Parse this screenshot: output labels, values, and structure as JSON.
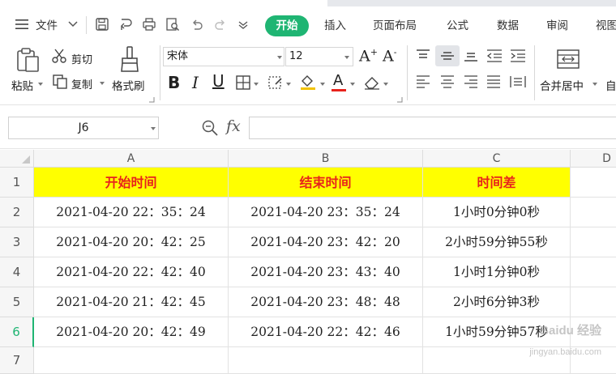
{
  "menu": {
    "file_label": "文件",
    "tabs": [
      "开始",
      "插入",
      "页面布局",
      "公式",
      "数据",
      "审阅",
      "视图"
    ],
    "active_tab": "开始"
  },
  "ribbon": {
    "paste_label": "粘贴",
    "cut_label": "剪切",
    "copy_label": "复制",
    "format_painter_label": "格式刷",
    "font_name": "宋体",
    "font_size": "12",
    "merge_label": "合并居中",
    "auto_label": "自"
  },
  "formula_bar": {
    "cell_ref": "J6",
    "fx_label": "fx",
    "content": ""
  },
  "sheet": {
    "columns": [
      "A",
      "B",
      "C",
      "D"
    ],
    "rows": [
      "1",
      "2",
      "3",
      "4",
      "5",
      "6",
      "7"
    ],
    "selected_row": "6",
    "headers": [
      "开始时间",
      "结束时间",
      "时间差"
    ],
    "data": [
      [
        "2021-04-20 22：35：24",
        "2021-04-20 23：35：24",
        "1小时0分钟0秒"
      ],
      [
        "2021-04-20 20：42：25",
        "2021-04-20 23：42：20",
        "2小时59分钟55秒"
      ],
      [
        "2021-04-20 22：42：40",
        "2021-04-20 23：43：40",
        "1小时1分钟0秒"
      ],
      [
        "2021-04-20 21：42：45",
        "2021-04-20 23：48：48",
        "2小时6分钟3秒"
      ],
      [
        "2021-04-20 20：42：49",
        "2021-04-20 22：42：46",
        "1小时59分钟57秒"
      ]
    ]
  },
  "watermark": {
    "line1": "Baidu 经验",
    "line2": "jingyan.baidu.com"
  },
  "colors": {
    "accent": "#1fb573",
    "header_fill": "#ffff00",
    "header_text": "#e8231c"
  }
}
